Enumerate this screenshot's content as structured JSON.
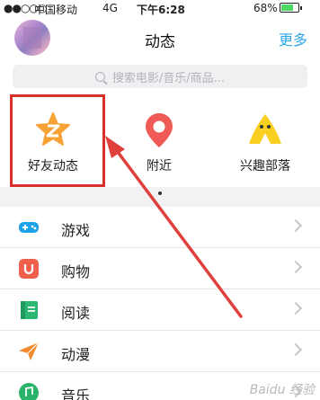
{
  "status_bar": {
    "signal": "●●○○○",
    "carrier": "中国移动",
    "network": "4G",
    "time": "下午6:28",
    "battery": "68%"
  },
  "header": {
    "title": "动态",
    "more": "更多"
  },
  "search": {
    "placeholder": "搜索电影/音乐/商品..."
  },
  "grid": [
    {
      "label": "好友动态",
      "icon": "star-z-icon",
      "color": "#f7a234"
    },
    {
      "label": "附近",
      "icon": "location-pin-icon",
      "color": "#ef5a56"
    },
    {
      "label": "兴趣部落",
      "icon": "tent-icon",
      "color": "#f9cf21"
    }
  ],
  "list": [
    {
      "label": "游戏",
      "icon": "gamepad-icon",
      "color": "#1fa2e8"
    },
    {
      "label": "购物",
      "icon": "shopping-bag-icon",
      "color": "#ef5f4c"
    },
    {
      "label": "阅读",
      "icon": "book-icon",
      "color": "#2bb673"
    },
    {
      "label": "动漫",
      "icon": "paper-plane-icon",
      "color": "#f1892d"
    },
    {
      "label": "音乐",
      "icon": "music-icon",
      "color": "#29b36b"
    }
  ],
  "watermark": "Baidu 经验",
  "colors": {
    "accent": "#2fa7e6",
    "highlight": "#d9302c"
  }
}
